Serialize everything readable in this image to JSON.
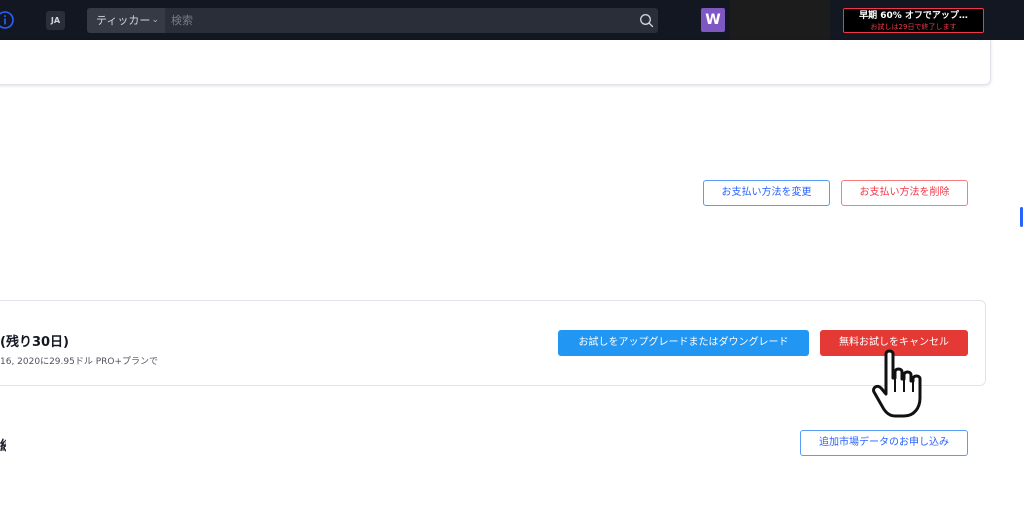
{
  "header": {
    "language": "JA",
    "ticker_label": "ティッカー",
    "search_placeholder": "検索",
    "avatar_letter": "W",
    "promo_main": "早期 60% オフでアップ…",
    "promo_sub": "お試しは29日で終了します"
  },
  "payment": {
    "change_label": "お支払い方法を変更",
    "delete_label": "お支払い方法を削除"
  },
  "trial": {
    "title": "(残り30日)",
    "subtitle": "16, 2020に29.95ドル PRO+プランで",
    "upgrade_label": "お試しをアップグレードまたはダウングレード",
    "cancel_label": "無料お試しをキャンセル"
  },
  "market_data": {
    "section_title_fragment": "続",
    "subscribe_label": "追加市場データのお申し込み"
  },
  "colors": {
    "topbar": "#131722",
    "accent_blue": "#2196f3",
    "danger_red": "#e53935",
    "avatar_purple": "#7e57c2"
  }
}
